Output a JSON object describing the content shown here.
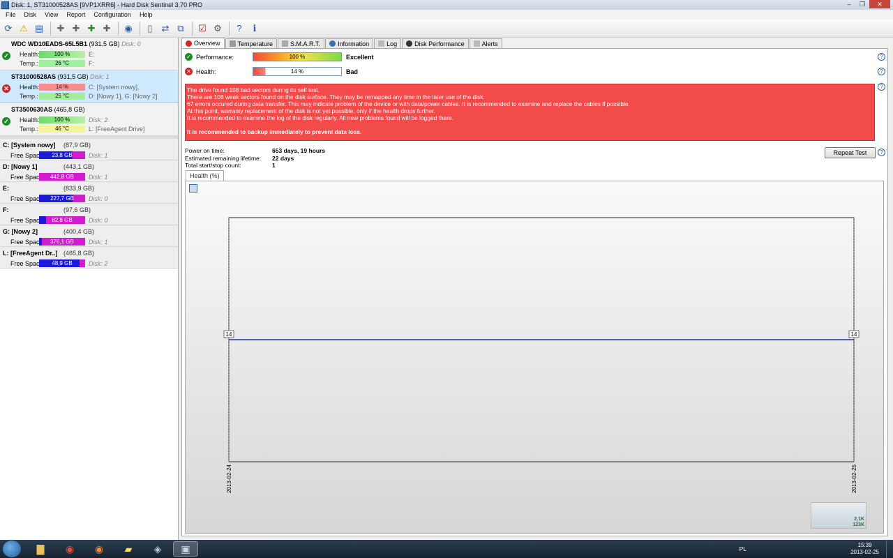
{
  "window": {
    "title": "Disk: 1, ST31000528AS [9VP1XRR6]  -  Hard Disk Sentinel 3.70 PRO"
  },
  "menu": [
    "File",
    "Disk",
    "View",
    "Report",
    "Configuration",
    "Help"
  ],
  "disks": [
    {
      "model": "WDC WD10EADS-65L5B1",
      "size": "(931,5 GB)",
      "index": "Disk: 0",
      "status": "ok",
      "health": "100 %",
      "health_parts": "E:",
      "temp": "26 °C",
      "temp_parts": "F:"
    },
    {
      "model": "ST31000528AS",
      "size": "(931,5 GB)",
      "index": "Disk: 1",
      "status": "bad",
      "health": "14 %",
      "health_parts": "C: [System nowy],",
      "temp": "25 °C",
      "temp_parts": "D: [Nowy 1], G: [Nowy 2]"
    },
    {
      "model": "ST3500630AS",
      "size": "(465,8 GB)",
      "index": "",
      "status": "ok",
      "health": "100 %",
      "health_parts": "Disk: 2",
      "temp": "46 °C",
      "temp_parts": "L: [FreeAgent Drive]"
    }
  ],
  "labels": {
    "health": "Health:",
    "temp": "Temp.:",
    "free_space": "Free Space"
  },
  "partitions": [
    {
      "name": "C: [System nowy]",
      "size": "(87,9 GB)",
      "free": "23,8 GB",
      "disk": "Disk: 1",
      "color": "#1a1ad8"
    },
    {
      "name": "D: [Nowy 1]",
      "size": "(443,1 GB)",
      "free": "442,8 GB",
      "disk": "Disk: 1",
      "color": "#d21cd2"
    },
    {
      "name": "E:",
      "size": "(833,9 GB)",
      "free": "227,7 GB",
      "disk": "Disk: 0",
      "color": "#1a1ad8"
    },
    {
      "name": "F:",
      "size": "(97,6 GB)",
      "free": "82,8 GB",
      "disk": "Disk: 0",
      "color": "#d21cd2"
    },
    {
      "name": "G: [Nowy 2]",
      "size": "(400,4 GB)",
      "free": "376,1 GB",
      "disk": "Disk: 1",
      "color": "#d21cd2"
    },
    {
      "name": "L: [FreeAgent Dr..]",
      "size": "(465,8 GB)",
      "free": "48,9 GB",
      "disk": "Disk: 2",
      "color": "#1a1ad8"
    }
  ],
  "tabs": [
    "Overview",
    "Temperature",
    "S.M.A.R.T.",
    "Information",
    "Log",
    "Disk Performance",
    "Alerts"
  ],
  "overview": {
    "performance_label": "Performance:",
    "performance_value": "100 %",
    "performance_text": "Excellent",
    "performance_level": 100,
    "health_label": "Health:",
    "health_value": "14 %",
    "health_text": "Bad",
    "health_level": 14,
    "alert_lines": [
      "The drive found 108 bad sectors during its self test.",
      "There are 108 weak sectors found on the disk surface. They may be remapped any time in the later use of the disk.",
      "67 errors occured during data transfer. This may indicate problem of the device or with data/power cables. It is recommended to examine and replace the cables if possible.",
      "At this point, warranty replacement of the disk is not yet possible, only if the health drops further.",
      "It is recommended to examine the log of the disk regularly. All new problems found will be logged there."
    ],
    "alert_bold": "It is recommended to backup immediately to prevent data loss.",
    "power_on_label": "Power on time:",
    "power_on_value": "653 days, 19 hours",
    "lifetime_label": "Estimated remaining lifetime:",
    "lifetime_value": "22 days",
    "startstop_label": "Total start/stop count:",
    "startstop_value": "1",
    "repeat_test": "Repeat Test",
    "chart_tab": "Health (%)"
  },
  "chart_data": {
    "type": "line",
    "x": [
      "2013-02-24",
      "2013-02-25"
    ],
    "series": [
      {
        "values": [
          14,
          14
        ]
      }
    ],
    "ylim": [
      0,
      28
    ],
    "data_labels": [
      "14",
      "14"
    ],
    "grid": false
  },
  "thumbnail": {
    "lines": [
      "2,1K",
      "123K"
    ]
  },
  "taskbar": {
    "lang": "PL",
    "time": "15:39",
    "date": "2013-02-25"
  },
  "colors": {
    "alert_bg": "#f34a4a",
    "series_line": "#1f2fa8",
    "ok": "#1d8a29",
    "bad": "#d32424"
  }
}
